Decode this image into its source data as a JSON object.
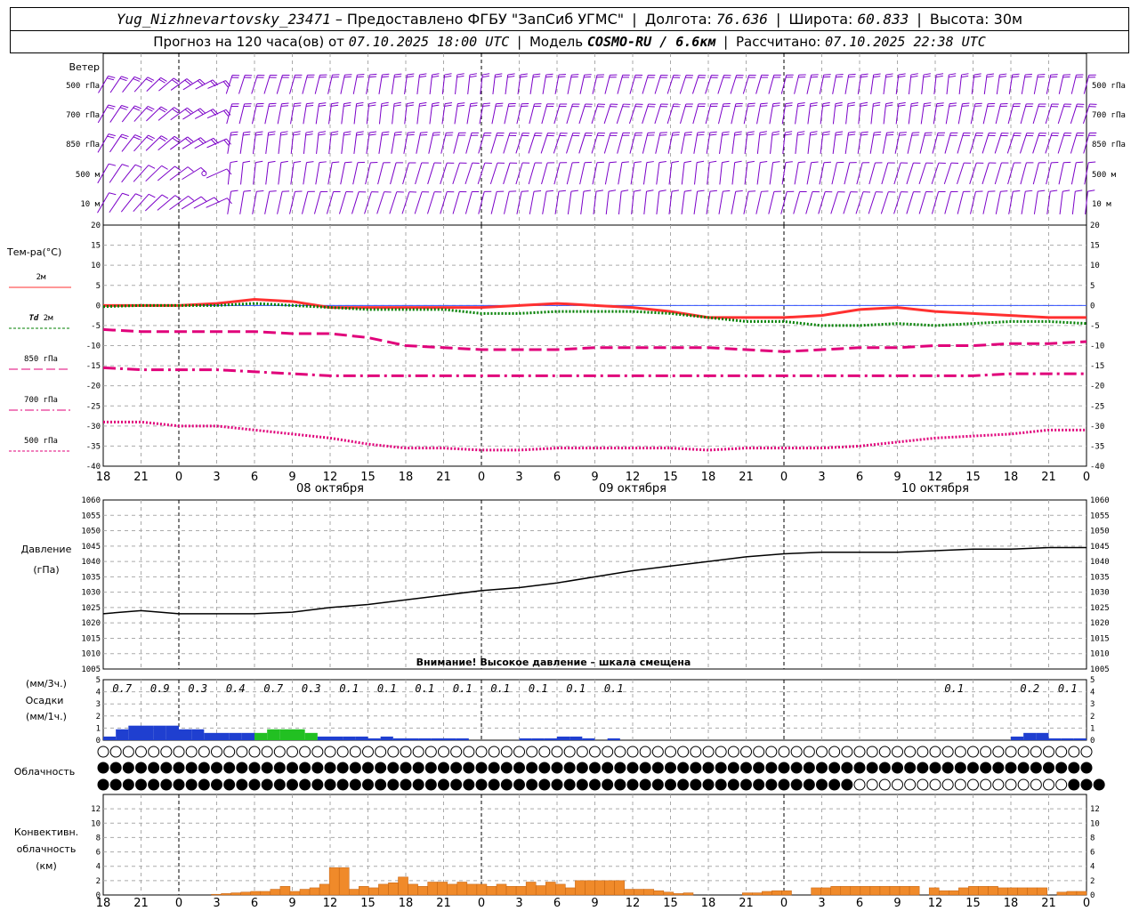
{
  "header": {
    "station": "Yug_Nizhnevartovsky_23471",
    "dash": "–",
    "provider": "Предоставлено ФГБУ \"ЗапСиб УГМС\"",
    "lon_label": "Долгота:",
    "lon": "76.636",
    "lat_label": "Широта:",
    "lat": "60.833",
    "alt_label": "Высота:",
    "alt": "30м",
    "forecast_label": "Прогноз на 120 часа(ов) от",
    "forecast_time": "07.10.2025 18:00 UTC",
    "model_label": "Модель",
    "model": "COSMO-RU / 6.6км",
    "computed_label": "Рассчитано:",
    "computed_time": "07.10.2025 22:38 UTC"
  },
  "time_axis": {
    "hour_labels": [
      "18",
      "21",
      "0",
      "3",
      "6",
      "9",
      "12",
      "15",
      "18",
      "21",
      "0",
      "3",
      "6",
      "9",
      "12",
      "15",
      "18",
      "21",
      "0",
      "3",
      "6",
      "9",
      "12",
      "15",
      "18",
      "21",
      "0"
    ],
    "dates": [
      {
        "label": "08 октября",
        "center_hour": 18
      },
      {
        "label": "09 октября",
        "center_hour": 42
      },
      {
        "label": "10 октября",
        "center_hour": 66
      }
    ],
    "start": "07.10.2025 18:00 UTC",
    "hours_total": 78,
    "midnight_hours": [
      6,
      30,
      54,
      78
    ]
  },
  "wind": {
    "title": "Ветер",
    "levels": [
      "500 гПа",
      "700 гПа",
      "850 гПа",
      "500 м",
      "10 м"
    ],
    "color": "#7b00c8",
    "calm_marker_hour": 8
  },
  "chart_data": [
    {
      "type": "line",
      "panel": "temperature",
      "title": "Тем-ра(°C)",
      "ylim": [
        -40,
        20
      ],
      "yticks": [
        20,
        15,
        10,
        5,
        0,
        -5,
        -10,
        -15,
        -20,
        -25,
        -30,
        -35,
        -40
      ],
      "x": [
        0,
        3,
        6,
        9,
        12,
        15,
        18,
        21,
        24,
        27,
        30,
        33,
        36,
        39,
        42,
        45,
        48,
        51,
        54,
        57,
        60,
        63,
        66,
        69,
        72,
        75,
        78
      ],
      "series": [
        {
          "name": "2м",
          "color": "#ff3030",
          "style": "solid",
          "values": [
            0,
            0,
            0,
            0.5,
            1.5,
            1,
            -0.5,
            -0.5,
            -0.5,
            -0.5,
            -0.5,
            0,
            0.5,
            0,
            -0.5,
            -1.5,
            -3,
            -3,
            -3,
            -2.5,
            -1,
            -0.5,
            -1.5,
            -2,
            -2.5,
            -3,
            -3
          ]
        },
        {
          "name": "Td 2м",
          "color": "#008000",
          "style": "dotted",
          "values": [
            -0.3,
            0,
            0,
            0,
            0.5,
            0,
            -0.5,
            -1,
            -1,
            -1,
            -2,
            -2,
            -1.5,
            -1.5,
            -1.5,
            -2,
            -3,
            -4,
            -4,
            -5,
            -5,
            -4.5,
            -5,
            -4.5,
            -4,
            -4,
            -4.5
          ]
        },
        {
          "name": "850 гПа",
          "color": "#e0007a",
          "style": "dashed",
          "values": [
            -6,
            -6.5,
            -6.5,
            -6.5,
            -6.5,
            -7,
            -7,
            -8,
            -10,
            -10.5,
            -11,
            -11,
            -11,
            -10.5,
            -10.5,
            -10.5,
            -10.5,
            -11,
            -11.5,
            -11,
            -10.5,
            -10.5,
            -10,
            -10,
            -9.5,
            -9.5,
            -9
          ]
        },
        {
          "name": "700 гПа",
          "color": "#e0007a",
          "style": "dashdot",
          "values": [
            -15.5,
            -16,
            -16,
            -16,
            -16.5,
            -17,
            -17.5,
            -17.5,
            -17.5,
            -17.5,
            -17.5,
            -17.5,
            -17.5,
            -17.5,
            -17.5,
            -17.5,
            -17.5,
            -17.5,
            -17.5,
            -17.5,
            -17.5,
            -17.5,
            -17.5,
            -17.5,
            -17,
            -17,
            -17
          ]
        },
        {
          "name": "500 гПа",
          "color": "#e0007a",
          "style": "dotted",
          "values": [
            -29,
            -29,
            -30,
            -30,
            -31,
            -32,
            -33,
            -34.5,
            -35.5,
            -35.5,
            -36,
            -36,
            -35.5,
            -35.5,
            -35.5,
            -35.5,
            -36,
            -35.5,
            -35.5,
            -35.5,
            -35,
            -34,
            -33,
            -32.5,
            -32,
            -31,
            -31
          ]
        }
      ]
    },
    {
      "type": "line",
      "panel": "pressure",
      "title": "Давление",
      "ylabel": "(гПа)",
      "ylim": [
        1005,
        1060
      ],
      "yticks": [
        1060,
        1055,
        1050,
        1045,
        1040,
        1035,
        1030,
        1025,
        1020,
        1015,
        1010,
        1005
      ],
      "x": [
        0,
        3,
        6,
        9,
        12,
        15,
        18,
        21,
        24,
        27,
        30,
        33,
        36,
        39,
        42,
        45,
        48,
        51,
        54,
        57,
        60,
        63,
        66,
        69,
        72,
        75,
        78
      ],
      "series": [
        {
          "color": "#000000",
          "values": [
            1023,
            1024,
            1023,
            1023,
            1023,
            1023.5,
            1025,
            1026,
            1027.5,
            1029,
            1030.5,
            1031.5,
            1033,
            1035,
            1037,
            1038.5,
            1040,
            1041.5,
            1042.5,
            1043,
            1043,
            1043,
            1043.5,
            1044,
            1044,
            1044.5,
            1044.5
          ]
        }
      ],
      "warning": "Внимание! Высокое давление – шкала смещена"
    },
    {
      "type": "bar",
      "panel": "precipitation",
      "title": "Осадки",
      "ylabel_top": "(мм/3ч.)",
      "ylabel_bottom": "(мм/1ч.)",
      "ylim": [
        0,
        5
      ],
      "yticks": [
        5,
        4,
        3,
        2,
        1,
        0
      ],
      "totals_3h": [
        {
          "hour": 1.5,
          "value": "0.7"
        },
        {
          "hour": 4.5,
          "value": "0.9"
        },
        {
          "hour": 7.5,
          "value": "0.3"
        },
        {
          "hour": 10.5,
          "value": "0.4"
        },
        {
          "hour": 13.5,
          "value": "0.7"
        },
        {
          "hour": 16.5,
          "value": "0.3"
        },
        {
          "hour": 19.5,
          "value": "0.1"
        },
        {
          "hour": 22.5,
          "value": "0.1"
        },
        {
          "hour": 25.5,
          "value": "0.1"
        },
        {
          "hour": 28.5,
          "value": "0.1"
        },
        {
          "hour": 31.5,
          "value": "0.1"
        },
        {
          "hour": 34.5,
          "value": "0.1"
        },
        {
          "hour": 37.5,
          "value": "0.1"
        },
        {
          "hour": 40.5,
          "value": "0.1"
        },
        {
          "hour": 67.5,
          "value": "0.1"
        },
        {
          "hour": 73.5,
          "value": "0.2"
        },
        {
          "hour": 76.5,
          "value": "0.1"
        }
      ],
      "hourly": [
        0.1,
        0.3,
        0.4,
        0.4,
        0.4,
        0.4,
        0.3,
        0.3,
        0.2,
        0.2,
        0.2,
        0.2,
        0.2,
        0.3,
        0.3,
        0.3,
        0.2,
        0.1,
        0.1,
        0.1,
        0.1,
        0.05,
        0.1,
        0.05,
        0.05,
        0.05,
        0.05,
        0.05,
        0.05,
        0,
        0,
        0,
        0,
        0.05,
        0.05,
        0.05,
        0.1,
        0.1,
        0.05,
        0,
        0.05,
        0,
        0,
        0,
        0,
        0,
        0,
        0,
        0,
        0,
        0,
        0,
        0,
        0,
        0,
        0,
        0,
        0,
        0,
        0,
        0,
        0,
        0,
        0,
        0,
        0,
        0,
        0,
        0,
        0,
        0,
        0,
        0.1,
        0.2,
        0.2,
        0.05,
        0.05,
        0.05
      ],
      "hourly_colors": {
        "rain": "#1f3fd0",
        "mixed": "#22c022"
      },
      "mixed_hours": [
        12,
        13,
        14,
        15,
        16
      ]
    },
    {
      "type": "bar",
      "panel": "convective_cloud",
      "title": "Конвективн.",
      "title2": "облачность",
      "ylabel": "(км)",
      "ylim": [
        0,
        14
      ],
      "yticks": [
        12,
        10,
        8,
        6,
        4,
        2,
        0
      ],
      "color": "#f08a2a",
      "hourly": [
        0,
        0,
        0,
        0,
        0,
        0,
        0,
        0,
        0,
        0,
        0,
        0.1,
        0.2,
        0.3,
        0.4,
        0.5,
        0.5,
        0.8,
        1.2,
        0.5,
        0.8,
        1,
        1.5,
        3.8,
        3.8,
        0.8,
        1.2,
        1,
        1.5,
        1.7,
        2.5,
        1.5,
        1.2,
        1.8,
        1.8,
        1.5,
        1.8,
        1.5,
        1.5,
        1.2,
        1.5,
        1.2,
        1.2,
        1.8,
        1.3,
        1.8,
        1.5,
        1,
        2,
        2,
        2,
        2,
        2,
        0.8,
        0.8,
        0.8,
        0.6,
        0.4,
        0.2,
        0.3,
        0,
        0,
        0,
        0,
        0,
        0.3,
        0.3,
        0.5,
        0.6,
        0.6,
        0,
        0,
        1,
        1,
        1.2,
        1.2,
        1.2,
        1.2,
        1.2,
        1.2,
        1.2,
        1.2,
        1.2,
        0,
        1,
        0.6,
        0.6,
        1,
        1.2,
        1.2,
        1.2,
        1,
        1,
        1,
        1,
        1,
        0,
        0.4,
        0.5,
        0.5
      ]
    }
  ],
  "clouds": {
    "title": "Облачность",
    "rows_legend": [
      "high",
      "middle",
      "low"
    ],
    "high": [
      0,
      0,
      0,
      0,
      0,
      0,
      0,
      0,
      0,
      0,
      0,
      0,
      0,
      0,
      0,
      0,
      0,
      0,
      0,
      0,
      0,
      0,
      0,
      0,
      0,
      0,
      0,
      0,
      0,
      0,
      0,
      0,
      0,
      0,
      0,
      0,
      0,
      0,
      0,
      0,
      0,
      0,
      0,
      0,
      0,
      0,
      0,
      0,
      0,
      0,
      0,
      0,
      0,
      0,
      0,
      0,
      0,
      0,
      0,
      0,
      0,
      0,
      0,
      0,
      0,
      0,
      0,
      0,
      0,
      0,
      0,
      0,
      0,
      0,
      0,
      0,
      0,
      0,
      0
    ],
    "middle": [
      8,
      8,
      8,
      8,
      8,
      8,
      8,
      8,
      8,
      8,
      8,
      8,
      8,
      8,
      8,
      8,
      8,
      8,
      8,
      8,
      8,
      8,
      8,
      8,
      8,
      8,
      8,
      8,
      8,
      8,
      8,
      8,
      8,
      8,
      8,
      8,
      8,
      8,
      8,
      8,
      8,
      8,
      8,
      8,
      8,
      8,
      8,
      8,
      8,
      8,
      8,
      8,
      8,
      8,
      8,
      8,
      8,
      8,
      8,
      8,
      8,
      8,
      8,
      8,
      8,
      8,
      8,
      8,
      8,
      8,
      8,
      8,
      8,
      8,
      8,
      8,
      8,
      8,
      8
    ],
    "low": [
      8,
      8,
      8,
      8,
      8,
      8,
      8,
      8,
      8,
      8,
      8,
      8,
      8,
      8,
      8,
      8,
      8,
      8,
      8,
      8,
      8,
      8,
      8,
      8,
      8,
      8,
      8,
      8,
      8,
      8,
      8,
      8,
      8,
      8,
      8,
      8,
      8,
      8,
      8,
      8,
      8,
      8,
      8,
      8,
      8,
      8,
      8,
      8,
      8,
      8,
      8,
      8,
      8,
      8,
      8,
      8,
      8,
      8,
      8,
      8,
      0,
      0,
      0,
      0,
      0,
      0,
      0,
      0,
      0,
      0,
      0,
      0,
      0,
      0,
      0,
      0,
      0,
      8,
      8,
      8
    ]
  },
  "legend": {
    "t2m": "2м",
    "td_italic": "Td",
    "td_suffix": "2м",
    "t850": "850 гПа",
    "t700": "700 гПа",
    "t500": "500 гПа"
  }
}
